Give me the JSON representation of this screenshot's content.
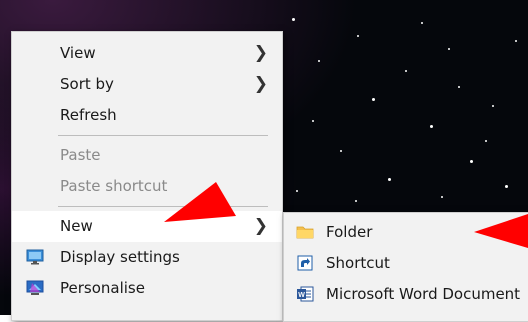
{
  "context_menu": {
    "items": [
      {
        "label": "View",
        "has_submenu": true
      },
      {
        "label": "Sort by",
        "has_submenu": true
      },
      {
        "label": "Refresh"
      },
      {
        "label": "Paste",
        "disabled": true
      },
      {
        "label": "Paste shortcut",
        "disabled": true
      },
      {
        "label": "New",
        "has_submenu": true,
        "highlighted": true
      },
      {
        "label": "Display settings",
        "icon": "display-settings-icon"
      },
      {
        "label": "Personalise",
        "icon": "personalise-icon"
      }
    ]
  },
  "new_submenu": {
    "items": [
      {
        "label": "Folder",
        "icon": "folder-icon"
      },
      {
        "label": "Shortcut",
        "icon": "shortcut-icon"
      },
      {
        "label": "Microsoft Word Document",
        "icon": "word-document-icon"
      }
    ]
  },
  "annotations": {
    "arrow_color": "#ff0000"
  }
}
